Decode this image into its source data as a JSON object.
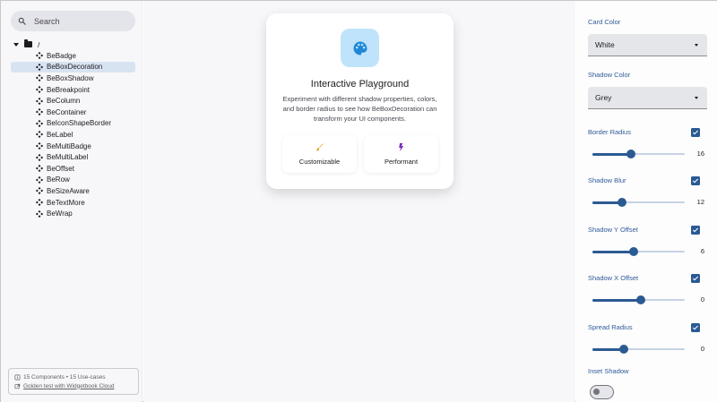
{
  "search": {
    "placeholder": "Search"
  },
  "tree": {
    "root_label": "/",
    "items": [
      {
        "label": "BeBadge",
        "selected": false
      },
      {
        "label": "BeBoxDecoration",
        "selected": true
      },
      {
        "label": "BeBoxShadow",
        "selected": false
      },
      {
        "label": "BeBreakpoint",
        "selected": false
      },
      {
        "label": "BeColumn",
        "selected": false
      },
      {
        "label": "BeContainer",
        "selected": false
      },
      {
        "label": "BeIconShapeBorder",
        "selected": false
      },
      {
        "label": "BeLabel",
        "selected": false
      },
      {
        "label": "BeMultiBadge",
        "selected": false
      },
      {
        "label": "BeMultiLabel",
        "selected": false
      },
      {
        "label": "BeOffset",
        "selected": false
      },
      {
        "label": "BeRow",
        "selected": false
      },
      {
        "label": "BeSizeAware",
        "selected": false
      },
      {
        "label": "BeTextMore",
        "selected": false
      },
      {
        "label": "BeWrap",
        "selected": false
      }
    ]
  },
  "footer": {
    "summary": "15 Components • 15 Use-cases",
    "link": "Golden test with Widgetbook Cloud"
  },
  "card": {
    "icon": "palette-icon",
    "title": "Interactive Playground",
    "description": "Experiment with different shadow properties, colors, and border radius to see how BeBoxDecoration can transform your UI components.",
    "features": [
      {
        "icon": "brush-icon",
        "label": "Customizable",
        "color": "#e0a21a"
      },
      {
        "icon": "bolt-icon",
        "label": "Performant",
        "color": "#7b2cbf"
      }
    ]
  },
  "panel": {
    "card_color": {
      "label": "Card Color",
      "value": "White"
    },
    "shadow_color": {
      "label": "Shadow Color",
      "value": "Grey"
    },
    "sliders": [
      {
        "key": "border-radius",
        "label": "Border Radius",
        "checked": true,
        "value": "16",
        "fraction": 0.42
      },
      {
        "key": "shadow-blur",
        "label": "Shadow Blur",
        "checked": true,
        "value": "12",
        "fraction": 0.32
      },
      {
        "key": "shadow-y-offset",
        "label": "Shadow Y Offset",
        "checked": true,
        "value": "6",
        "fraction": 0.45
      },
      {
        "key": "shadow-x-offset",
        "label": "Shadow X Offset",
        "checked": true,
        "value": "0",
        "fraction": 0.52
      },
      {
        "key": "spread-radius",
        "label": "Spread Radius",
        "checked": true,
        "value": "0",
        "fraction": 0.34
      }
    ],
    "inset_shadow": {
      "label": "Inset Shadow",
      "on": false
    }
  },
  "colors": {
    "accent": "#2b5a93",
    "label": "#2f5b9a",
    "selection": "#d8e3f2",
    "icon_bg": "#bfe3fb",
    "palette_icon": "#1f88d6"
  }
}
